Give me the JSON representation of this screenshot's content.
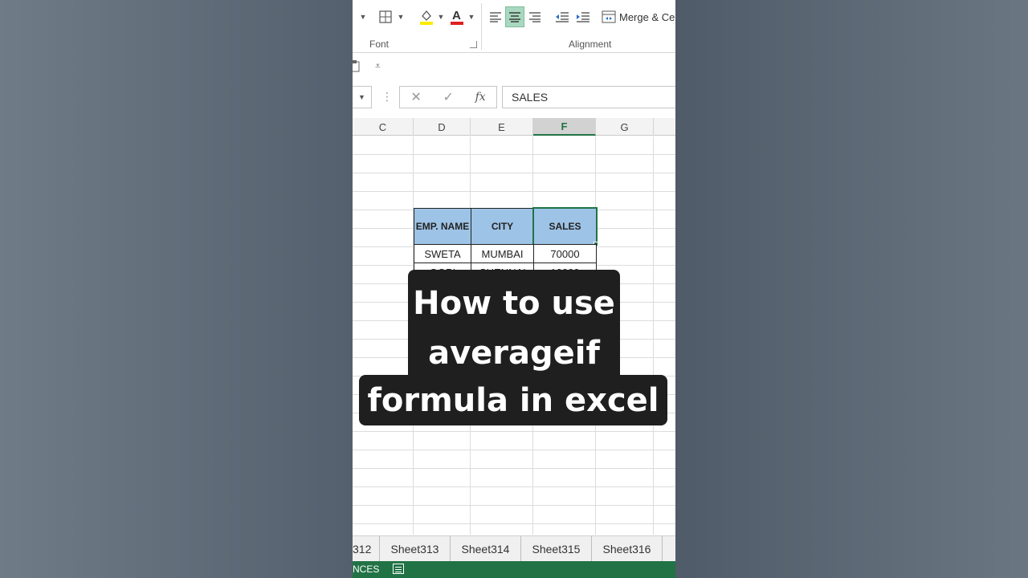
{
  "ribbon": {
    "font_group_label": "Font",
    "alignment_group_label": "Alignment",
    "merge_label": "Merge & Ce"
  },
  "formula_bar": {
    "cancel_symbol": "✕",
    "enter_symbol": "✓",
    "fx_symbol": "fx",
    "content": "SALES"
  },
  "columns": [
    "C",
    "D",
    "E",
    "F",
    "G"
  ],
  "selected_column": "F",
  "table": {
    "headers": [
      "EMP. NAME",
      "CITY",
      "SALES"
    ],
    "rows": [
      [
        "SWETA",
        "MUMBAI",
        "70000"
      ],
      [
        "GOPI",
        "CHENNAI",
        "10000"
      ]
    ]
  },
  "overlay": {
    "line1": "How to use",
    "line2": "averageif",
    "line3": "formula in excel"
  },
  "sheet_tabs": [
    "312",
    "Sheet313",
    "Sheet314",
    "Sheet315",
    "Sheet316"
  ],
  "status": {
    "text": "NCES"
  },
  "colors": {
    "excel_green": "#217346",
    "header_fill": "#9dc3e6",
    "overlay_bg": "#1f1f1f"
  }
}
